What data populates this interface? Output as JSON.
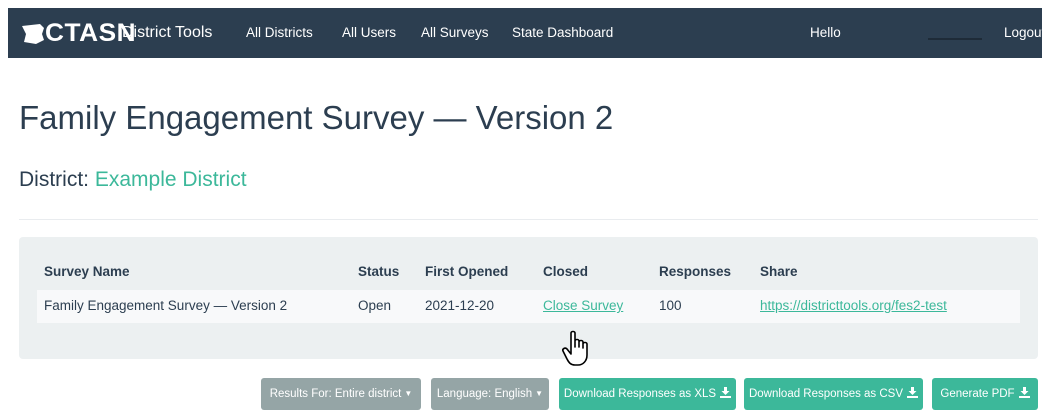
{
  "navbar": {
    "brand": "CTASN",
    "title": "District Tools",
    "links": [
      "All Districts",
      "All Users",
      "All Surveys",
      "State Dashboard"
    ],
    "greeting": "Hello",
    "logout": "Logout"
  },
  "page": {
    "title": "Family Engagement Survey — Version 2",
    "district_label": "District:",
    "district_name": "Example District"
  },
  "table": {
    "headers": [
      "Survey Name",
      "Status",
      "First Opened",
      "Closed",
      "Responses",
      "Share"
    ],
    "rows": [
      {
        "survey_name": "Family Engagement Survey — Version 2",
        "status": "Open",
        "first_opened": "2021-12-20",
        "closed": "Close Survey",
        "responses": "100",
        "share": "https://districttools.org/fes2-test"
      }
    ]
  },
  "actions": {
    "results_for": "Results For: Entire district",
    "language": "Language: English",
    "download_xls": "Download Responses as XLS",
    "download_csv": "Download Responses as CSV",
    "generate_pdf": "Generate PDF"
  },
  "colors": {
    "navbar": "#2c3e50",
    "accent": "#3cb89a",
    "panel": "#ecf0f1",
    "gray_button": "#95a5a6"
  },
  "icons": {
    "logo": "ct-state-logo-icon",
    "download": "download-icon",
    "dropdown": "caret-down-icon",
    "cursor": "hand-pointer-cursor-icon"
  }
}
